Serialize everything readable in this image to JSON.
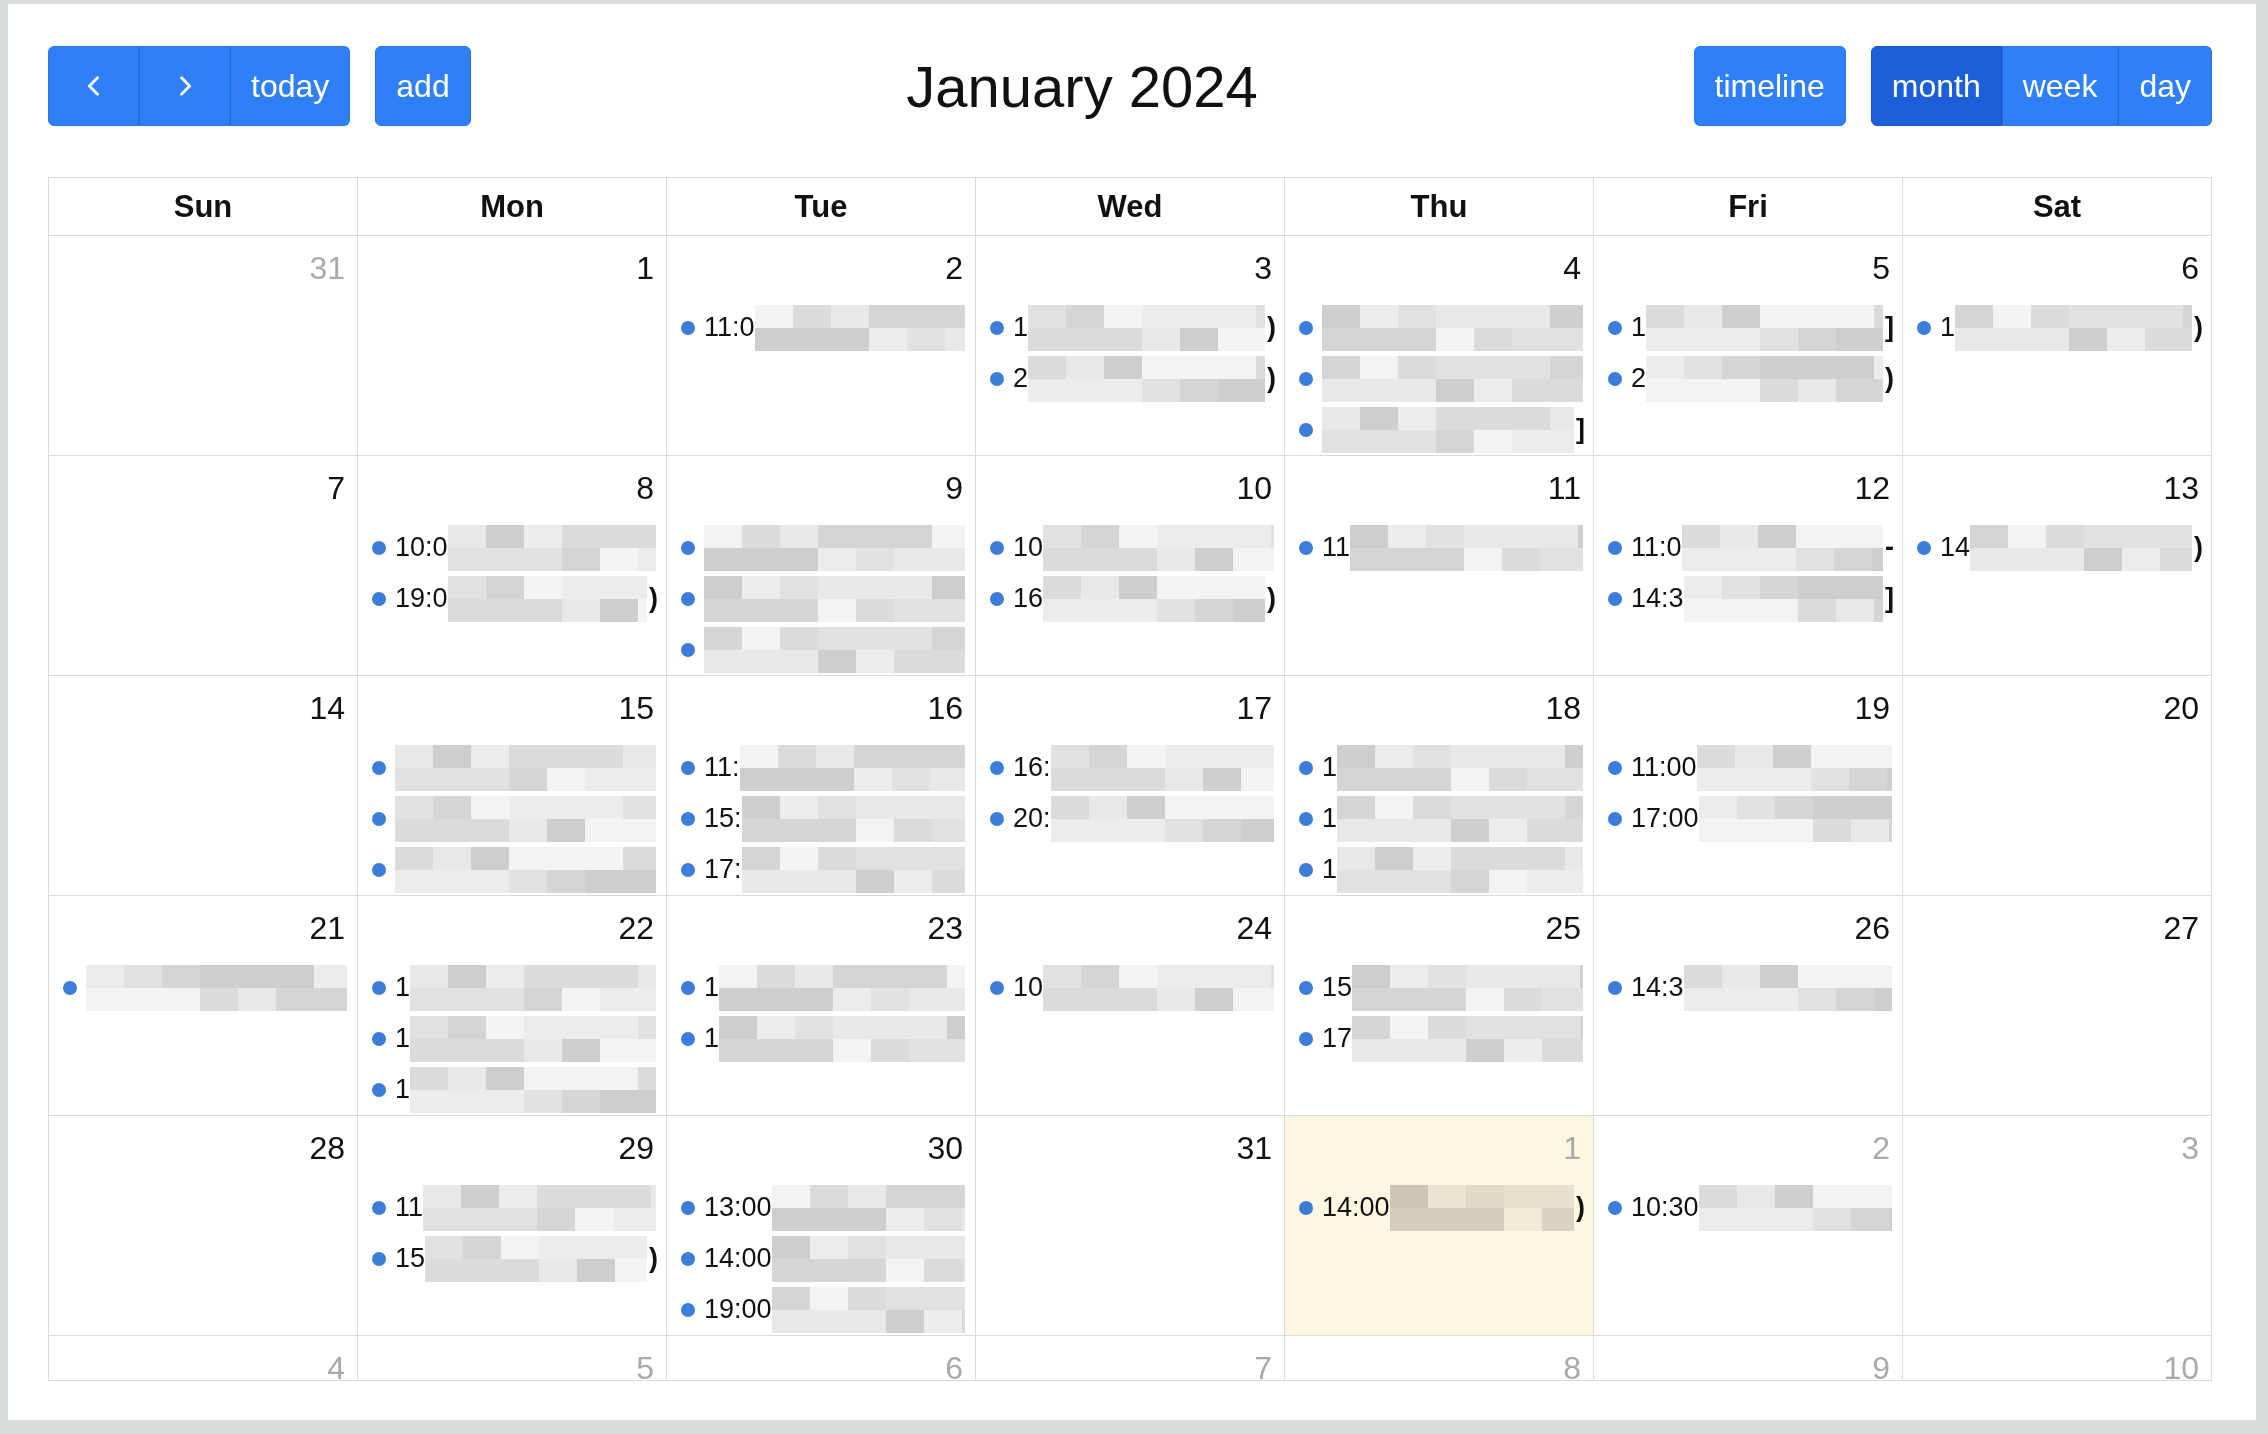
{
  "toolbar": {
    "nav_buttons": [
      {
        "kind": "prev"
      },
      {
        "kind": "next"
      },
      {
        "kind": "text",
        "label": "today"
      }
    ],
    "add_button": "add",
    "title": "January 2024",
    "timeline_button": "timeline",
    "views": [
      {
        "label": "month",
        "selected": true
      },
      {
        "label": "week",
        "selected": false
      },
      {
        "label": "day",
        "selected": false
      }
    ]
  },
  "calendar": {
    "weekdays": [
      "Sun",
      "Mon",
      "Tue",
      "Wed",
      "Thu",
      "Fri",
      "Sat"
    ],
    "weeks": [
      {
        "days": [
          {
            "date": "31",
            "other_month": true,
            "today": false
          },
          {
            "date": "1",
            "other_month": false,
            "today": false
          },
          {
            "date": "2",
            "other_month": false,
            "today": false,
            "events": [
              {
                "redacted": true,
                "text_start": "11:0"
              }
            ]
          },
          {
            "date": "3",
            "other_month": false,
            "today": false,
            "events": [
              {
                "redacted": true,
                "text_start": "1",
                "text_end": ")"
              },
              {
                "redacted": true,
                "text_start": "2",
                "text_end": ")"
              }
            ]
          },
          {
            "date": "4",
            "other_month": false,
            "today": false,
            "events": [
              {
                "redacted": true
              },
              {
                "redacted": true
              },
              {
                "redacted": true,
                "text_end": "]"
              }
            ]
          },
          {
            "date": "5",
            "other_month": false,
            "today": false,
            "events": [
              {
                "redacted": true,
                "text_start": "1",
                "text_end": "]"
              },
              {
                "redacted": true,
                "text_start": "2",
                "text_end": ")"
              }
            ]
          },
          {
            "date": "6",
            "other_month": false,
            "today": false,
            "events": [
              {
                "redacted": true,
                "text_start": "1",
                "text_end": ")"
              }
            ]
          }
        ]
      },
      {
        "days": [
          {
            "date": "7",
            "other_month": false,
            "today": false
          },
          {
            "date": "8",
            "other_month": false,
            "today": false,
            "events": [
              {
                "redacted": true,
                "text_start": "10:0"
              },
              {
                "redacted": true,
                "text_start": "19:0",
                "text_end": ")"
              }
            ]
          },
          {
            "date": "9",
            "other_month": false,
            "today": false,
            "events": [
              {
                "redacted": true
              },
              {
                "redacted": true
              },
              {
                "redacted": true
              }
            ]
          },
          {
            "date": "10",
            "other_month": false,
            "today": false,
            "events": [
              {
                "redacted": true,
                "text_start": "10"
              },
              {
                "redacted": true,
                "text_start": "16",
                "text_end": ")"
              }
            ]
          },
          {
            "date": "11",
            "other_month": false,
            "today": false,
            "events": [
              {
                "redacted": true,
                "text_start": "11"
              }
            ]
          },
          {
            "date": "12",
            "other_month": false,
            "today": false,
            "events": [
              {
                "redacted": true,
                "text_start": "11:0",
                "text_end": "-"
              },
              {
                "redacted": true,
                "text_start": "14:3",
                "text_end": "]"
              }
            ]
          },
          {
            "date": "13",
            "other_month": false,
            "today": false,
            "events": [
              {
                "redacted": true,
                "text_start": "14",
                "text_end": ")"
              }
            ]
          }
        ]
      },
      {
        "days": [
          {
            "date": "14",
            "other_month": false,
            "today": false
          },
          {
            "date": "15",
            "other_month": false,
            "today": false,
            "events": [
              {
                "redacted": true
              },
              {
                "redacted": true
              },
              {
                "redacted": true
              }
            ]
          },
          {
            "date": "16",
            "other_month": false,
            "today": false,
            "events": [
              {
                "redacted": true,
                "text_start": "11:"
              },
              {
                "redacted": true,
                "text_start": "15:"
              },
              {
                "redacted": true,
                "text_start": "17:"
              }
            ]
          },
          {
            "date": "17",
            "other_month": false,
            "today": false,
            "events": [
              {
                "redacted": true,
                "text_start": "16:"
              },
              {
                "redacted": true,
                "text_start": "20:"
              }
            ]
          },
          {
            "date": "18",
            "other_month": false,
            "today": false,
            "events": [
              {
                "redacted": true,
                "text_start": "1"
              },
              {
                "redacted": true,
                "text_start": "1"
              },
              {
                "redacted": true,
                "text_start": "1"
              }
            ]
          },
          {
            "date": "19",
            "other_month": false,
            "today": false,
            "events": [
              {
                "redacted": true,
                "text_start": "11:00"
              },
              {
                "redacted": true,
                "text_start": "17:00"
              }
            ]
          },
          {
            "date": "20",
            "other_month": false,
            "today": false
          }
        ]
      },
      {
        "days": [
          {
            "date": "21",
            "other_month": false,
            "today": false,
            "events": [
              {
                "redacted": true
              }
            ]
          },
          {
            "date": "22",
            "other_month": false,
            "today": false,
            "events": [
              {
                "redacted": true,
                "text_start": "1"
              },
              {
                "redacted": true,
                "text_start": "1"
              },
              {
                "redacted": true,
                "text_start": "1"
              }
            ]
          },
          {
            "date": "23",
            "other_month": false,
            "today": false,
            "events": [
              {
                "redacted": true,
                "text_start": "1"
              },
              {
                "redacted": true,
                "text_start": "1"
              }
            ]
          },
          {
            "date": "24",
            "other_month": false,
            "today": false,
            "events": [
              {
                "redacted": true,
                "text_start": "10"
              }
            ]
          },
          {
            "date": "25",
            "other_month": false,
            "today": false,
            "events": [
              {
                "redacted": true,
                "text_start": "15"
              },
              {
                "redacted": true,
                "text_start": "17"
              }
            ]
          },
          {
            "date": "26",
            "other_month": false,
            "today": false,
            "events": [
              {
                "redacted": true,
                "text_start": "14:3"
              }
            ]
          },
          {
            "date": "27",
            "other_month": false,
            "today": false
          }
        ]
      },
      {
        "days": [
          {
            "date": "28",
            "other_month": false,
            "today": false
          },
          {
            "date": "29",
            "other_month": false,
            "today": false,
            "events": [
              {
                "redacted": true,
                "text_start": "11"
              },
              {
                "redacted": true,
                "text_start": "15",
                "text_end": ")"
              }
            ]
          },
          {
            "date": "30",
            "other_month": false,
            "today": false,
            "events": [
              {
                "redacted": true,
                "text_start": "13:00"
              },
              {
                "redacted": true,
                "text_start": "14:00"
              },
              {
                "redacted": true,
                "text_start": "19:00"
              }
            ]
          },
          {
            "date": "31",
            "other_month": false,
            "today": false
          },
          {
            "date": "1",
            "other_month": true,
            "today": true,
            "events": [
              {
                "redacted": true,
                "text_start": "14:00",
                "text_end": ")"
              }
            ]
          },
          {
            "date": "2",
            "other_month": true,
            "today": false,
            "events": [
              {
                "redacted": true,
                "text_start": "10:30"
              }
            ]
          },
          {
            "date": "3",
            "other_month": true,
            "today": false
          }
        ]
      },
      {
        "days": [
          {
            "date": "4",
            "other_month": true,
            "today": false
          },
          {
            "date": "5",
            "other_month": true,
            "today": false
          },
          {
            "date": "6",
            "other_month": true,
            "today": false
          },
          {
            "date": "7",
            "other_month": true,
            "today": false
          },
          {
            "date": "8",
            "other_month": true,
            "today": false
          },
          {
            "date": "9",
            "other_month": true,
            "today": false
          },
          {
            "date": "10",
            "other_month": true,
            "today": false
          }
        ]
      }
    ]
  }
}
